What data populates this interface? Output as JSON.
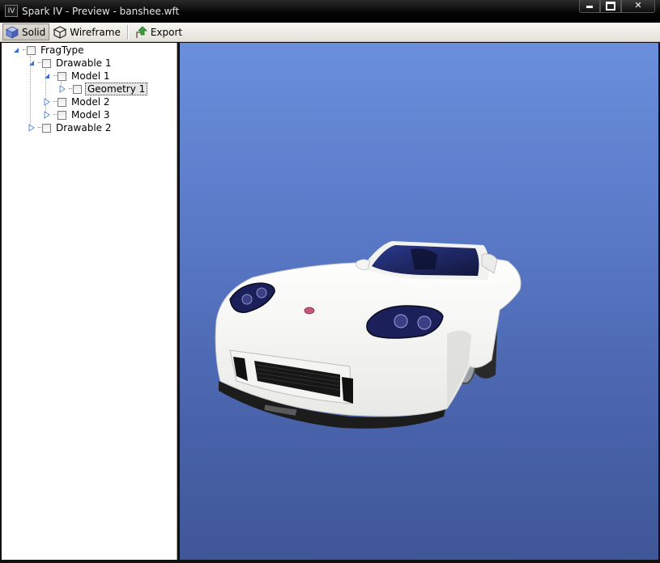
{
  "window": {
    "title": "Spark IV - Preview - banshee.wft",
    "app_icon_text": "IV",
    "controls": {
      "minimize": "minimize",
      "maximize": "maximize",
      "close": "✕"
    }
  },
  "toolbar": {
    "solid_label": "Solid",
    "wireframe_label": "Wireframe",
    "export_label": "Export",
    "active_mode": "Solid"
  },
  "tree": {
    "root_label": "FragType",
    "drawable1_label": "Drawable 1",
    "model1_label": "Model 1",
    "geometry1_label": "Geometry 1",
    "model2_label": "Model 2",
    "model3_label": "Model 3",
    "drawable2_label": "Drawable 2",
    "selected": "Geometry 1"
  },
  "viewport": {
    "subject": "car-model-preview",
    "background_top": "#6a8fdc",
    "background_bottom": "#3f5797",
    "car_color": "#f8f8f6"
  }
}
